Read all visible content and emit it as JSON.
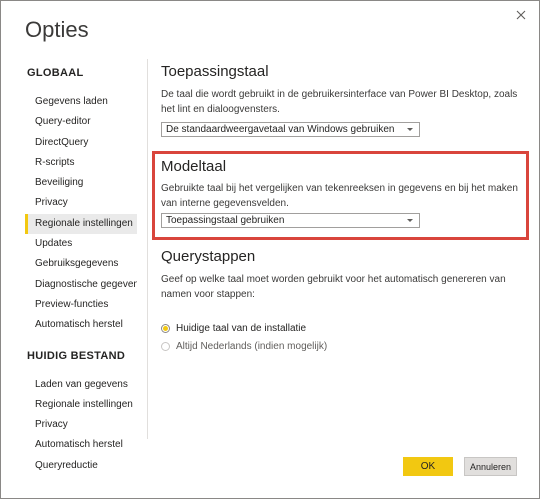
{
  "window": {
    "title": "Opties",
    "close_icon": "close-icon"
  },
  "nav": {
    "global_heading": "GLOBAAL",
    "global_items": [
      {
        "label": "Gegevens laden",
        "selected": false
      },
      {
        "label": "Query-editor",
        "selected": false
      },
      {
        "label": "DirectQuery",
        "selected": false
      },
      {
        "label": "R-scripts",
        "selected": false
      },
      {
        "label": "Beveiliging",
        "selected": false
      },
      {
        "label": "Privacy",
        "selected": false
      },
      {
        "label": "Regionale instellingen",
        "selected": true
      },
      {
        "label": "Updates",
        "selected": false
      },
      {
        "label": "Gebruiksgegevens",
        "selected": false
      },
      {
        "label": "Diagnostische gegevens",
        "selected": false
      },
      {
        "label": "Preview-functies",
        "selected": false
      },
      {
        "label": "Automatisch herstel",
        "selected": false
      }
    ],
    "file_heading": "HUIDIG BESTAND",
    "file_items": [
      {
        "label": "Laden van gegevens"
      },
      {
        "label": "Regionale instellingen"
      },
      {
        "label": "Privacy"
      },
      {
        "label": "Automatisch herstel"
      },
      {
        "label": "Queryreductie"
      }
    ]
  },
  "app_language": {
    "title": "Toepassingstaal",
    "description": "De taal die wordt gebruikt in de gebruikersinterface van Power BI Desktop, zoals het lint en dialoogvensters.",
    "selected": "De standaardweergavetaal van Windows gebruiken"
  },
  "model_language": {
    "title": "Modeltaal",
    "description": "Gebruikte taal bij het vergelijken van tekenreeksen in gegevens en bij het maken van interne gegevensvelden.",
    "selected": "Toepassingstaal gebruiken",
    "highlight_color": "#d9453c"
  },
  "query_steps": {
    "title": "Querystappen",
    "description": "Geef op welke taal moet worden gebruikt voor het automatisch genereren van namen voor stappen:",
    "options": [
      {
        "label": "Huidige taal van de installatie",
        "checked": true
      },
      {
        "label": "Altijd Nederlands (indien mogelijk)",
        "checked": false
      }
    ]
  },
  "footer": {
    "ok_label": "OK",
    "cancel_label": "Annuleren"
  },
  "colors": {
    "accent": "#f2c811",
    "highlight": "#d9453c"
  }
}
